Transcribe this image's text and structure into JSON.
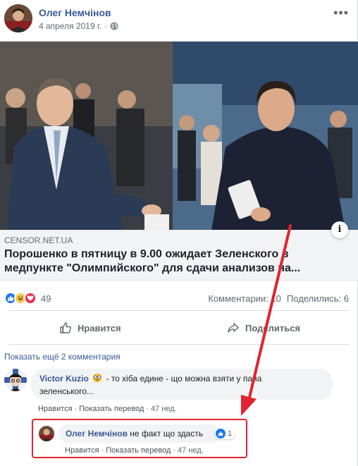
{
  "post": {
    "author": "Олег Немчінов",
    "date": "4 апреля 2019 г.",
    "more_icon": "more-horizontal-icon",
    "privacy_icon": "globe-icon"
  },
  "link_preview": {
    "domain": "CENSOR.NET.UA",
    "title": "Порошенко в пятницу в 9.00 ожидает Зеленского в медпункте \"Олимпийского\" для сдачи анализов на...",
    "info_icon": "info-icon"
  },
  "reactions": {
    "icons": [
      "like-reaction-icon",
      "haha-reaction-icon",
      "love-reaction-icon"
    ],
    "count": "49",
    "comments": "Комментарии: 10",
    "shares": "Поделились: 6"
  },
  "actions": {
    "like": "Нравится",
    "share": "Поделиться"
  },
  "comments": {
    "show_more": "Показать ещё 2 комментария",
    "items": [
      {
        "author": "Victor Kuzio",
        "emoji": "nerd-face-emoji",
        "text_line1": " - то хіба едине - що можна взяти у пана",
        "text_line2": "зеленського...",
        "like": "Нравится",
        "translate": "Показать перевод",
        "time": "47 нед."
      },
      {
        "author": "Олег Немчінов",
        "text": " не факт що здасть",
        "likes": "1",
        "like": "Нравится",
        "translate": "Показать перевод",
        "time": "47 нед."
      }
    ]
  },
  "colors": {
    "link_blue": "#385898",
    "highlight_red": "#e0242f",
    "like_blue": "#1877f2"
  }
}
